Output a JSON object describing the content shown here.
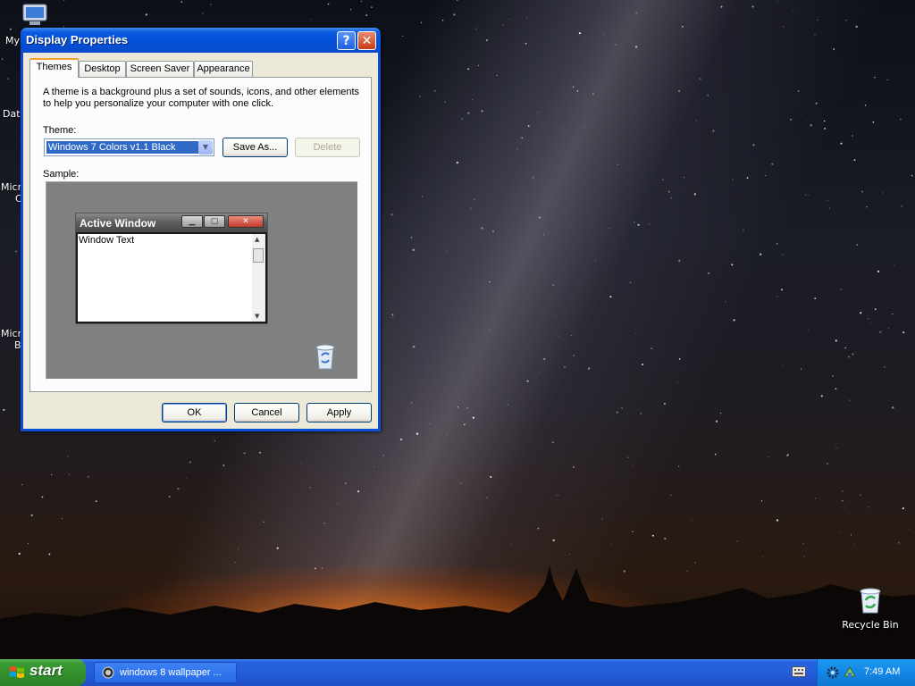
{
  "desktop": {
    "partial_labels": [
      "My",
      "Dat",
      "Micro",
      "C",
      "Micro",
      "B"
    ],
    "recycle_bin_label": "Recycle Bin"
  },
  "window": {
    "title": "Display Properties",
    "help_glyph": "?",
    "close_glyph": "✕",
    "tabs": [
      {
        "label": "Themes",
        "active": true
      },
      {
        "label": "Desktop",
        "active": false
      },
      {
        "label": "Screen Saver",
        "active": false
      },
      {
        "label": "Appearance",
        "active": false
      }
    ],
    "description": "A theme is a background plus a set of sounds, icons, and other elements to help you personalize your computer with one click.",
    "theme_label": "Theme:",
    "theme_value": "Windows 7 Colors v1.1 Black",
    "save_as_label": "Save As...",
    "delete_label": "Delete",
    "sample_label": "Sample:",
    "sample": {
      "active_window_title": "Active Window",
      "window_text": "Window Text"
    },
    "ok_label": "OK",
    "cancel_label": "Cancel",
    "apply_label": "Apply"
  },
  "taskbar": {
    "start_label": "start",
    "task_item_label": "windows 8 wallpaper ...",
    "clock": "7:49 AM"
  },
  "colors": {
    "title_bar": "#0a5ae0",
    "taskbar": "#245edb",
    "start_button": "#318f2b",
    "tray": "#1387e6",
    "selection": "#316ac5"
  }
}
